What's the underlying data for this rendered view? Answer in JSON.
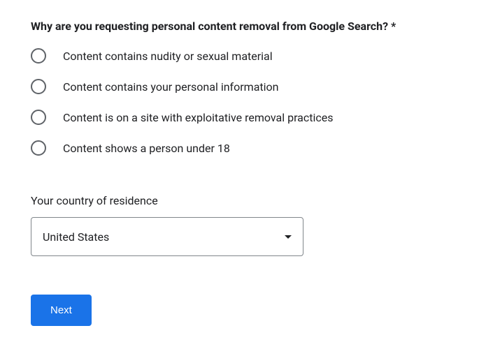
{
  "question": {
    "label": "Why are you requesting personal content removal from Google Search? *",
    "options": [
      "Content contains nudity or sexual material",
      "Content contains your personal information",
      "Content is on a site with exploitative removal practices",
      "Content shows a person under 18"
    ]
  },
  "country": {
    "label": "Your country of residence",
    "selected": "United States"
  },
  "actions": {
    "next": "Next"
  }
}
